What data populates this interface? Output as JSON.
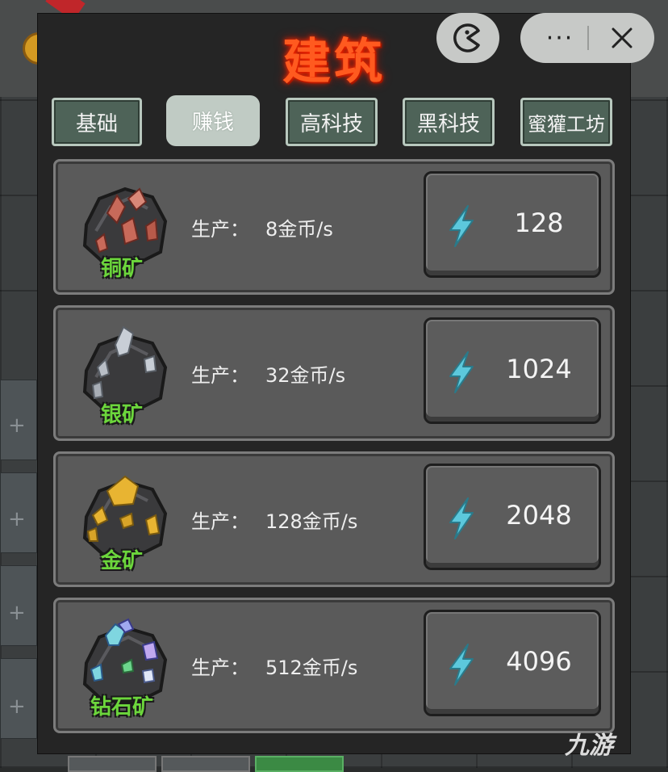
{
  "panel": {
    "title": "建筑",
    "tabs": [
      {
        "label": "基础",
        "active": false
      },
      {
        "label": "赚钱",
        "active": true
      },
      {
        "label": "高科技",
        "active": false
      },
      {
        "label": "黑科技",
        "active": false
      },
      {
        "label": "蜜獾工坊",
        "active": false
      }
    ],
    "production_label": "生产：",
    "buildings": [
      {
        "name": "铜矿",
        "production": "8金币/s",
        "cost": "128",
        "ore_icon": "copper-ore-icon",
        "crystal_color": "#c86a5a"
      },
      {
        "name": "银矿",
        "production": "32金币/s",
        "cost": "1024",
        "ore_icon": "silver-ore-icon",
        "crystal_color": "#c8ced6"
      },
      {
        "name": "金矿",
        "production": "128金币/s",
        "cost": "2048",
        "ore_icon": "gold-ore-icon",
        "crystal_color": "#e8b432"
      },
      {
        "name": "钻石矿",
        "production": "512金币/s",
        "cost": "4096",
        "ore_icon": "diamond-ore-icon",
        "crystal_color": "#7fd6e0"
      }
    ]
  },
  "system_buttons": {
    "game_icon": "pacman-icon",
    "more_icon": "more-dots-icon",
    "more_glyph": "···",
    "close_icon": "close-icon"
  },
  "colors": {
    "title": "#ff5a1f",
    "tab_bg": "#4e6358",
    "tab_active_bg": "#c0cbc4",
    "row_bg": "#5a5a5a",
    "ore_name": "#6cd63c",
    "bolt": "#5cc8dc"
  },
  "watermark": "九游"
}
